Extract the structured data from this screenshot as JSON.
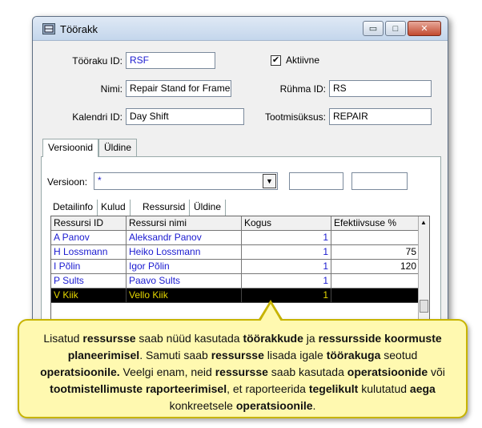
{
  "window": {
    "title": "Töörakk",
    "controls": {
      "minimize": "▭",
      "maximize": "□",
      "close": "✕"
    }
  },
  "form": {
    "workcell_id_label": "Tööraku ID:",
    "workcell_id_value": "RSF",
    "active_label": "Aktiivne",
    "active_checked": true,
    "name_label": "Nimi:",
    "name_value": "Repair Stand for Frames",
    "group_id_label": "Rühma ID:",
    "group_id_value": "RS",
    "calendar_id_label": "Kalendri ID:",
    "calendar_id_value": "Day Shift",
    "production_unit_label": "Tootmisüksus:",
    "production_unit_value": "REPAIR"
  },
  "outer_tabs": [
    {
      "label": "Versioonid",
      "active": true
    },
    {
      "label": "Üldine",
      "active": false
    }
  ],
  "version": {
    "label": "Versioon:",
    "value": "*"
  },
  "inner_tabs": [
    {
      "label": "Detailinfo",
      "active": false
    },
    {
      "label": "Kulud",
      "active": false
    },
    {
      "label": "Ressursid",
      "active": true
    },
    {
      "label": "Üldine",
      "active": false
    }
  ],
  "table": {
    "columns": [
      "Ressursi ID",
      "Ressursi nimi",
      "Kogus",
      "Efektiivsuse %"
    ],
    "rows": [
      {
        "id": "A Panov",
        "name": "Aleksandr Panov",
        "qty": "1",
        "eff": "",
        "selected": false
      },
      {
        "id": "H Lossmann",
        "name": "Heiko Lossmann",
        "qty": "1",
        "eff": "75",
        "selected": false
      },
      {
        "id": "I Põlin",
        "name": "Igor Põlin",
        "qty": "1",
        "eff": "120",
        "selected": false
      },
      {
        "id": "P Sults",
        "name": "Paavo Sults",
        "qty": "1",
        "eff": "",
        "selected": false
      },
      {
        "id": "V Kiik",
        "name": "Vello Kiik",
        "qty": "1",
        "eff": "",
        "selected": true
      }
    ]
  },
  "callout": {
    "t1": "Lisatud ",
    "b1": "ressursse",
    "t2": " saab nüüd kasutada ",
    "b2": "töörakkude",
    "t3": " ja ",
    "b3": "ressursside koormuste planeerimisel",
    "t4": ". Samuti saab ",
    "b4": "ressursse",
    "t5": " lisada igale ",
    "b5": "töörakuga",
    "t6": " seotud ",
    "b6": "operatsioonile.",
    "t7": " Veelgi enam, neid ",
    "b7": "ressursse",
    "t8": " saab kasutada ",
    "b8": "operatsioonide",
    "t9": " või ",
    "b9": "tootmistellimuste raporteerimisel",
    "t10": ", et raporteerida ",
    "b10": "tegelikult",
    "t11": " kulutatud ",
    "b11": "aega",
    "t12": " konkreetsele ",
    "b12": "operatsioonile",
    "t13": "."
  }
}
